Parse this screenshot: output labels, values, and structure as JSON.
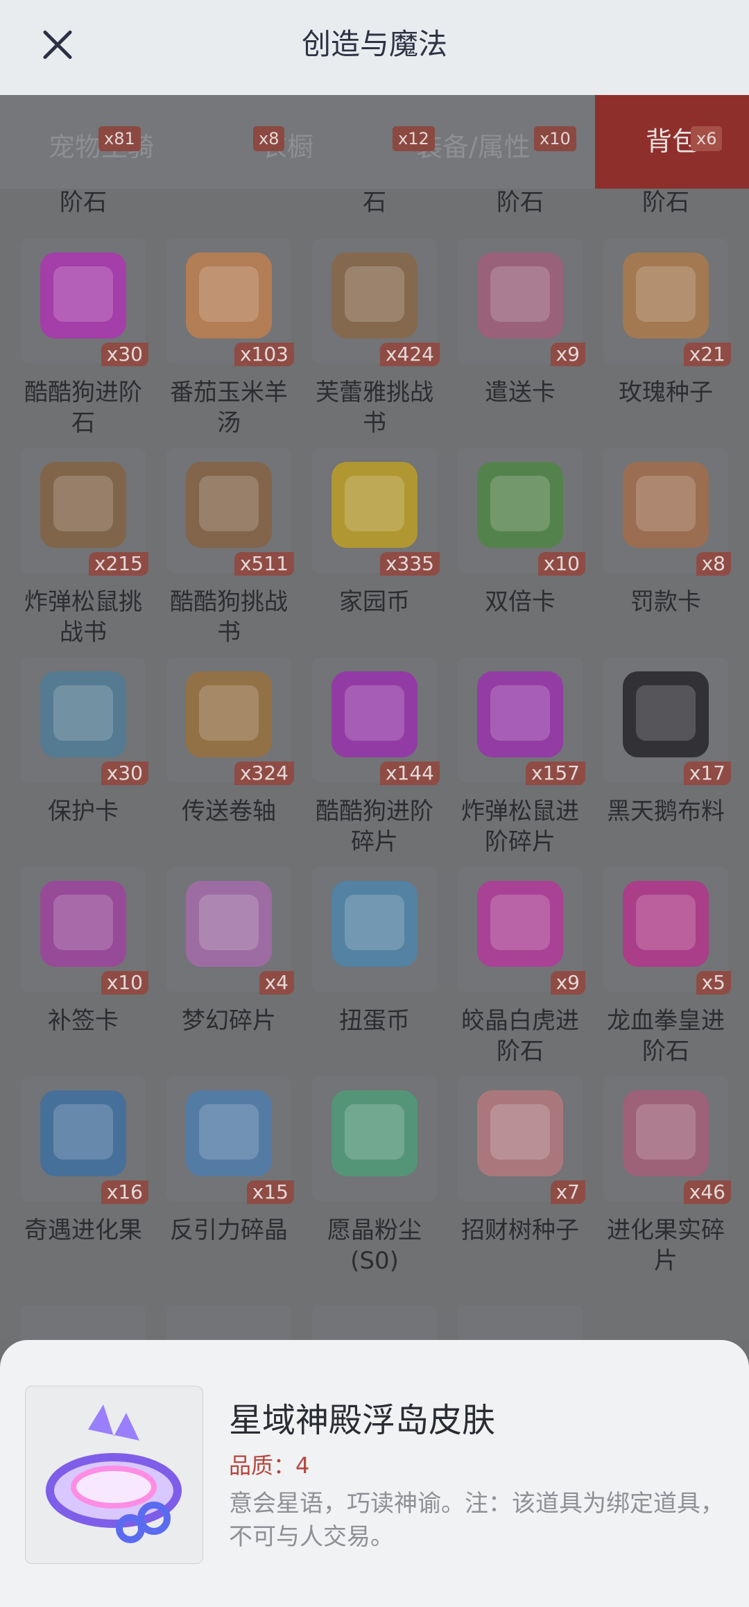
{
  "header": {
    "title": "创造与魔法"
  },
  "tabs": [
    {
      "label": "宠物坐骑",
      "badge": "x81"
    },
    {
      "label": "衣橱",
      "badge": "x8"
    },
    {
      "label": "装备/属性",
      "badge": "x12"
    },
    {
      "label": "",
      "badge": "x10"
    },
    {
      "label": "背包",
      "badge": "x6",
      "active": true
    }
  ],
  "partial_row": [
    "阶石",
    "石",
    "阶石",
    "阶石"
  ],
  "items": [
    {
      "name": "酷酷狗进阶石",
      "count": "x30",
      "icon": "purple-gem-goggles-icon",
      "color": "#b22fb7"
    },
    {
      "name": "番茄玉米羊汤",
      "count": "x103",
      "icon": "soup-bowl-icon",
      "color": "#c5804b"
    },
    {
      "name": "芙蕾雅挑战书",
      "count": "x424",
      "icon": "wanted-scroll-icon",
      "color": "#8a6744"
    },
    {
      "name": "遣送卡",
      "count": "x9",
      "icon": "pink-card-icon",
      "color": "#a45c7b"
    },
    {
      "name": "玫瑰种子",
      "count": "x21",
      "icon": "seed-bag-rose-icon",
      "color": "#b17b46"
    },
    {
      "name": "炸弹松鼠挑战书",
      "count": "x215",
      "icon": "wanted-scroll-icon",
      "color": "#85613e"
    },
    {
      "name": "酷酷狗挑战书",
      "count": "x511",
      "icon": "wanted-scroll-icon",
      "color": "#86613f"
    },
    {
      "name": "家园币",
      "count": "x335",
      "icon": "gold-coin-icon",
      "color": "#c1a21d"
    },
    {
      "name": "双倍卡",
      "count": "x10",
      "icon": "green-card-icon",
      "color": "#4c8640"
    },
    {
      "name": "罚款卡",
      "count": "x8",
      "icon": "orange-card-icon",
      "color": "#a66c47"
    },
    {
      "name": "保护卡",
      "count": "x30",
      "icon": "shield-card-icon",
      "color": "#4c7e99"
    },
    {
      "name": "传送卷轴",
      "count": "x324",
      "icon": "teleport-scroll-icon",
      "color": "#9c7138"
    },
    {
      "name": "酷酷狗进阶碎片",
      "count": "x144",
      "icon": "purple-gem-goggles-icon",
      "color": "#9b2cb1"
    },
    {
      "name": "炸弹松鼠进阶碎片",
      "count": "x157",
      "icon": "purple-gem-acorn-icon",
      "color": "#9c2db1"
    },
    {
      "name": "黑天鹅布料",
      "count": "x17",
      "icon": "black-cloth-icon",
      "color": "#1f1f24"
    },
    {
      "name": "补签卡",
      "count": "x10",
      "icon": "ticket-icon",
      "color": "#a23fa0"
    },
    {
      "name": "梦幻碎片",
      "count": "x4",
      "icon": "puzzle-piece-icon",
      "color": "#a86aae"
    },
    {
      "name": "扭蛋币",
      "count": "",
      "icon": "blue-coin-icon",
      "color": "#4a86ae"
    },
    {
      "name": "皎晶白虎进阶石",
      "count": "x9",
      "icon": "pink-gem-claw-icon",
      "color": "#b8359c"
    },
    {
      "name": "龙血拳皇进阶石",
      "count": "x5",
      "icon": "pink-gem-horns-icon",
      "color": "#ba2f8d"
    },
    {
      "name": "奇遇进化果",
      "count": "x16",
      "icon": "blue-fruit-icon",
      "color": "#3a6fa4"
    },
    {
      "name": "反引力碎晶",
      "count": "x15",
      "icon": "crystal-shards-icon",
      "color": "#4c7db1"
    },
    {
      "name": "愿晶粉尘(S0)",
      "count": "",
      "icon": "green-dust-icon",
      "color": "#4b9f77"
    },
    {
      "name": "招财树种子",
      "count": "x7",
      "icon": "seed-bag-tree-icon",
      "color": "#ba7a7d"
    },
    {
      "name": "进化果实碎片",
      "count": "x46",
      "icon": "fruit-slice-icon",
      "color": "#a95c79"
    }
  ],
  "detail": {
    "name": "星域神殿浮岛皮肤",
    "quality": "品质：4",
    "description": "意会星语，巧读神谕。注：该道具为绑定道具，不可与人交易。",
    "icon": "floating-island-icon"
  }
}
